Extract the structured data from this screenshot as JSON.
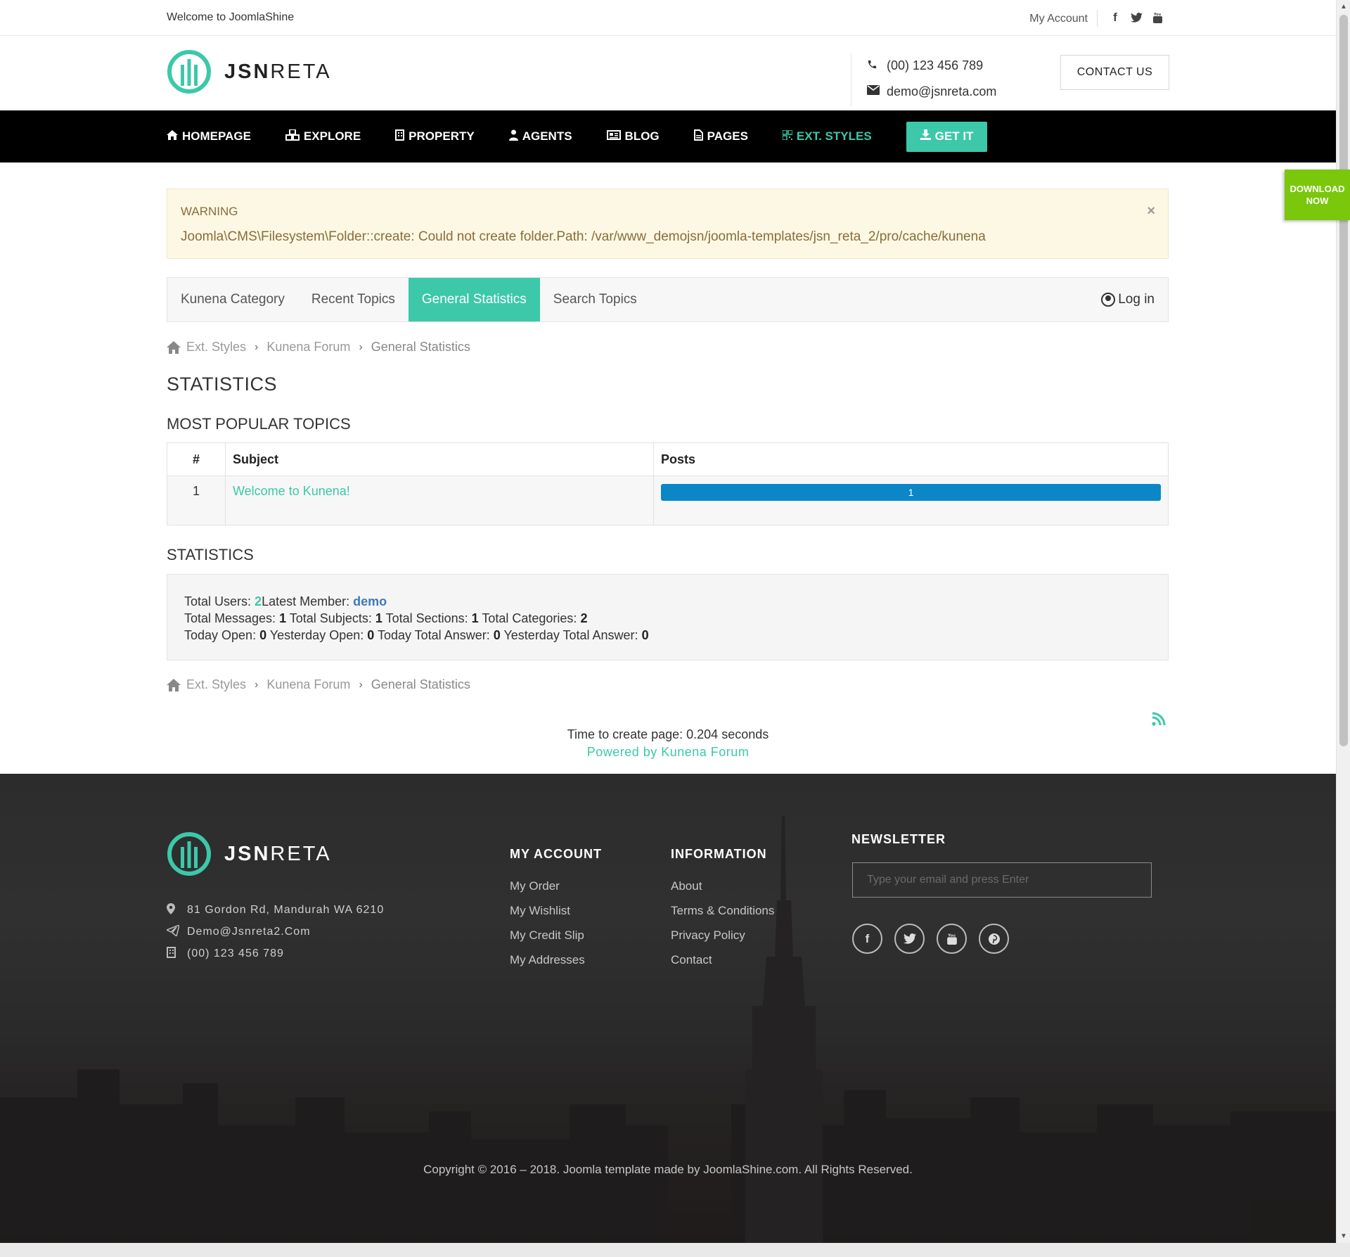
{
  "topbar": {
    "welcome": "Welcome to JoomlaShine",
    "account": "My Account",
    "social_icons": [
      "facebook-icon",
      "twitter-icon",
      "youtube-icon"
    ]
  },
  "brand": {
    "name_bold": "JSN",
    "name_light": "RETA",
    "accent": "#3cc8a9"
  },
  "header": {
    "phone": "(00) 123 456 789",
    "email": "demo@jsnreta.com",
    "contact_button": "CONTACT US"
  },
  "nav": {
    "items": [
      {
        "label": "HOMEPAGE",
        "icon": "home-icon"
      },
      {
        "label": "EXPLORE",
        "icon": "cubes-icon"
      },
      {
        "label": "PROPERTY",
        "icon": "building-icon"
      },
      {
        "label": "AGENTS",
        "icon": "user-icon"
      },
      {
        "label": "BLOG",
        "icon": "newspaper-icon"
      },
      {
        "label": "PAGES",
        "icon": "file-icon"
      },
      {
        "label": "EXT. STYLES",
        "icon": "qrcode-icon",
        "active": true
      }
    ],
    "cta": "GET IT"
  },
  "download_tab": {
    "line1": "DOWNLOAD",
    "line2": "NOW",
    "color": "#7ac70c"
  },
  "warning": {
    "heading": "WARNING",
    "message": "Joomla\\CMS\\Filesystem\\Folder::create: Could not create folder.Path: /var/www_demojsn/joomla-templates/jsn_reta_2/pro/cache/kunena"
  },
  "forum_tabs": {
    "tabs": [
      "Kunena Category",
      "Recent Topics",
      "General Statistics",
      "Search Topics"
    ],
    "active_index": 2,
    "login": "Log in"
  },
  "breadcrumb": {
    "items": [
      "Ext. Styles",
      "Kunena Forum",
      "General Statistics"
    ]
  },
  "main": {
    "title": "STATISTICS",
    "popular_heading": "MOST POPULAR TOPICS",
    "table": {
      "headers": [
        "#",
        "Subject",
        "Posts"
      ],
      "rows": [
        {
          "num": "1",
          "subject": "Welcome to Kunena!",
          "posts": "1",
          "posts_fraction": 1.0
        }
      ]
    },
    "stats_heading": "STATISTICS",
    "stats": {
      "total_users_label": "Total Users:",
      "total_users": "2",
      "latest_member_label": "Latest Member:",
      "latest_member": "demo",
      "total_messages_label": "Total Messages:",
      "total_messages": "1",
      "total_subjects_label": "Total Subjects:",
      "total_subjects": "1",
      "total_sections_label": "Total Sections:",
      "total_sections": "1",
      "total_categories_label": "Total Categories:",
      "total_categories": "2",
      "today_open_label": "Today Open:",
      "today_open": "0",
      "yesterday_open_label": "Yesterday Open:",
      "yesterday_open": "0",
      "today_answer_label": "Today Total Answer:",
      "today_answer": "0",
      "yesterday_answer_label": "Yesterday Total Answer:",
      "yesterday_answer": "0"
    },
    "page_time": "Time to create page: 0.204 seconds",
    "powered_by": "Powered by Kunena Forum"
  },
  "footer": {
    "address": "81 Gordon Rd, Mandurah WA 6210",
    "email": "Demo@Jsnreta2.Com",
    "phone": "(00) 123 456 789",
    "my_account": {
      "heading": "MY ACCOUNT",
      "links": [
        "My Order",
        "My Wishlist",
        "My Credit Slip",
        "My Addresses"
      ]
    },
    "information": {
      "heading": "INFORMATION",
      "links": [
        "About",
        "Terms & Conditions",
        "Privacy Policy",
        "Contact"
      ]
    },
    "newsletter": {
      "heading": "NEWSLETTER",
      "placeholder": "Type your email and press Enter"
    },
    "social_icons": [
      "facebook-icon",
      "twitter-icon",
      "youtube-icon",
      "pinterest-icon"
    ],
    "copyright": "Copyright © 2016 – 2018. Joomla template made by JoomlaShine.com. All Rights Reserved."
  }
}
